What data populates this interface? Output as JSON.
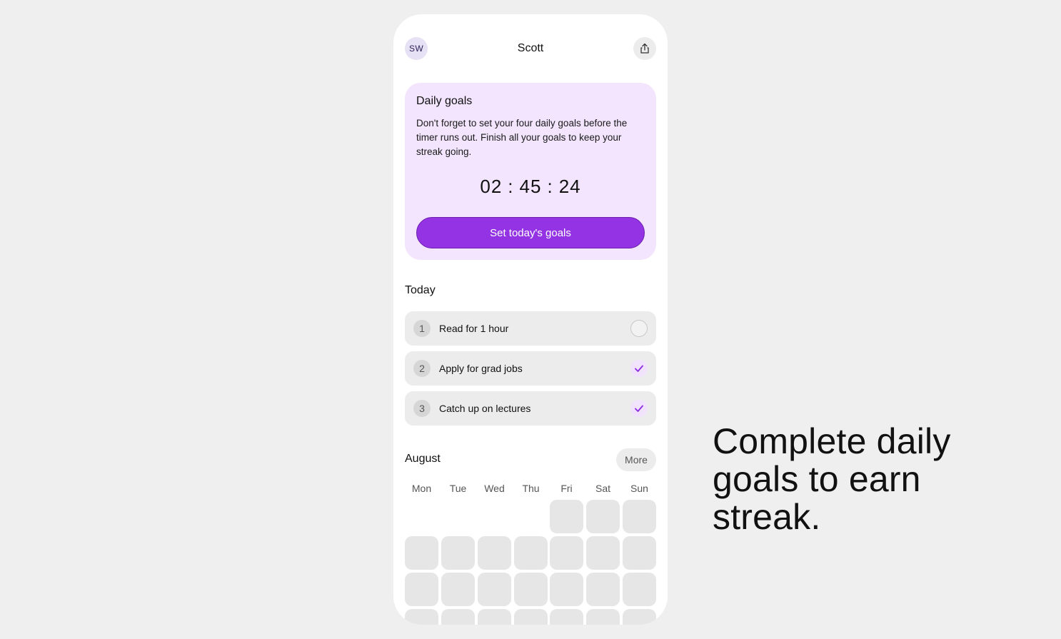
{
  "header": {
    "avatar_initials": "SW",
    "title": "Scott",
    "share_icon": "share-icon"
  },
  "goals_card": {
    "title": "Daily goals",
    "description": "Don't forget to set your four daily goals before the timer runs out. Finish all your goals to keep your streak going.",
    "timer": {
      "hours": "02",
      "minutes": "45",
      "seconds": "24",
      "separator": ":"
    },
    "button_label": "Set today's goals"
  },
  "today": {
    "title": "Today",
    "goals": [
      {
        "number": "1",
        "label": "Read for 1 hour",
        "done": false
      },
      {
        "number": "2",
        "label": "Apply for grad jobs",
        "done": true
      },
      {
        "number": "3",
        "label": "Catch up on lectures",
        "done": true
      }
    ]
  },
  "calendar": {
    "month": "August",
    "more_label": "More",
    "weekdays": [
      "Mon",
      "Tue",
      "Wed",
      "Thu",
      "Fri",
      "Sat",
      "Sun"
    ]
  },
  "tagline": "Complete daily goals to earn streak.",
  "colors": {
    "accent": "#9333e3",
    "card_bg": "#f2e5fd",
    "page_bg": "#efefef"
  }
}
